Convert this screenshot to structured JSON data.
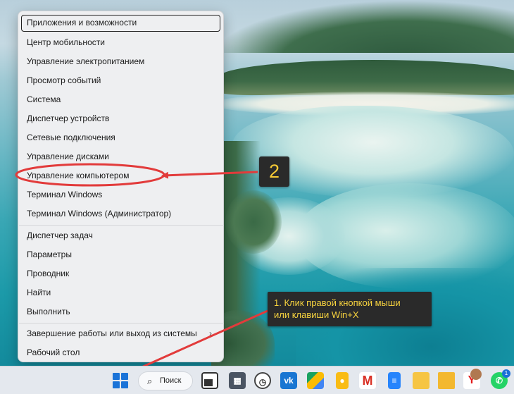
{
  "context_menu": {
    "items": [
      {
        "label": "Приложения и возможности"
      },
      {
        "label": "Центр мобильности"
      },
      {
        "label": "Управление электропитанием"
      },
      {
        "label": "Просмотр событий"
      },
      {
        "label": "Система"
      },
      {
        "label": "Диспетчер устройств"
      },
      {
        "label": "Сетевые подключения"
      },
      {
        "label": "Управление дисками"
      },
      {
        "label": "Управление компьютером"
      },
      {
        "label": "Терминал Windows"
      },
      {
        "label": "Терминал Windows (Администратор)"
      },
      {
        "label": "Диспетчер задач"
      },
      {
        "label": "Параметры"
      },
      {
        "label": "Проводник"
      },
      {
        "label": "Найти"
      },
      {
        "label": "Выполнить"
      },
      {
        "label": "Завершение работы или выход из системы",
        "submenu_chevron": "›"
      },
      {
        "label": "Рабочий стол"
      }
    ],
    "focused_item": "Приложения и возможности",
    "highlighted_item": "Управление компьютером"
  },
  "annotations": {
    "step_badge": "2",
    "callout_line1": "1. Клик правой кнопкой мыши",
    "callout_line2": "или клавиши Win+X",
    "accent_color": "#e23b3b",
    "badge_text_color": "#f5c935"
  },
  "taskbar": {
    "search_label": "Поиск",
    "search_icon": "search-icon",
    "notification_badge": "1",
    "apps": [
      "windows-start-icon",
      "task-view-icon",
      "calculator-icon",
      "clock-app-icon",
      "vk-icon",
      "google-drive-icon",
      "google-keep-icon",
      "gmail-icon",
      "google-docs-icon",
      "notes-app-icon",
      "file-explorer-icon",
      "yandex-browser-icon",
      "user-avatar-app-icon",
      "whatsapp-icon"
    ]
  }
}
